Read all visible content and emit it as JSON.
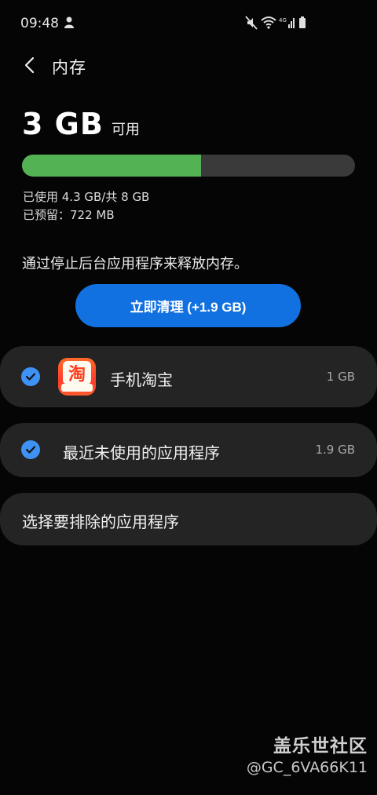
{
  "status_bar": {
    "time": "09:48",
    "icons": [
      "notification-person-icon",
      "mute-icon",
      "wifi-icon",
      "lte-signal-icon",
      "battery-icon"
    ]
  },
  "header": {
    "title": "内存",
    "back_icon": "chevron-left-icon"
  },
  "memory": {
    "available_value": "3 GB",
    "available_unit": "可用",
    "used_fraction": 0.5375,
    "used_text": "已使用 4.3 GB/共 8 GB",
    "reserved_text": "已预留：722 MB",
    "colors": {
      "used": "#53b354",
      "track": "#3a3a3a"
    }
  },
  "description": "通过停止后台应用程序来释放内存。",
  "clean_button": {
    "label": "立即清理 (+1.9 GB)",
    "color": "#1271e0"
  },
  "items": [
    {
      "label": "手机淘宝",
      "size": "1 GB",
      "checked": true,
      "icon": "taobao-app-icon"
    },
    {
      "label": "最近未使用的应用程序",
      "size": "1.9 GB",
      "checked": true
    }
  ],
  "exclude": {
    "label": "选择要排除的应用程序"
  },
  "watermark": {
    "title": "盖乐世社区",
    "user": "@GC_6VA66K11"
  }
}
